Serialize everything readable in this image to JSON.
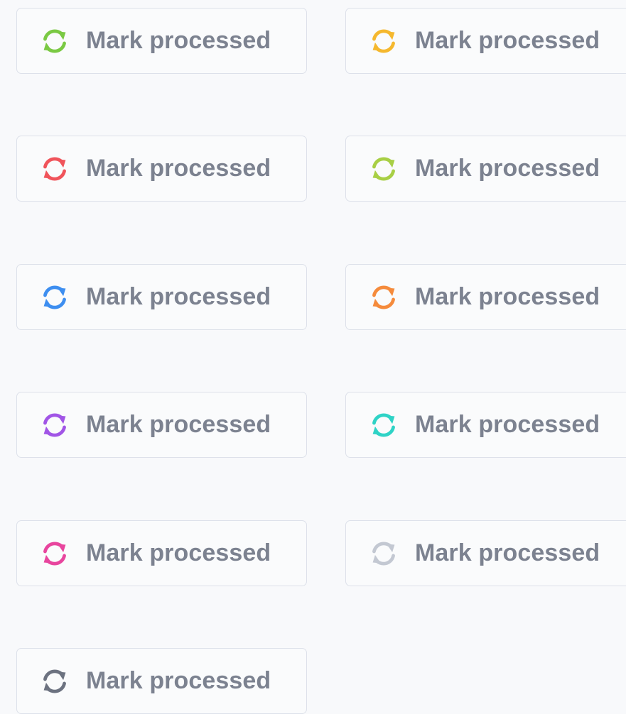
{
  "buttons": [
    {
      "label": "Mark processed",
      "icon": "refresh-icon",
      "color": "#7ac943"
    },
    {
      "label": "Mark processed",
      "icon": "refresh-icon",
      "color": "#f5b82e"
    },
    {
      "label": "Mark processed",
      "icon": "refresh-icon",
      "color": "#f0545b"
    },
    {
      "label": "Mark processed",
      "icon": "refresh-icon",
      "color": "#a8cf45"
    },
    {
      "label": "Mark processed",
      "icon": "refresh-icon",
      "color": "#3d8ef0"
    },
    {
      "label": "Mark processed",
      "icon": "refresh-icon",
      "color": "#f58b3c"
    },
    {
      "label": "Mark processed",
      "icon": "refresh-icon",
      "color": "#a155e6"
    },
    {
      "label": "Mark processed",
      "icon": "refresh-icon",
      "color": "#2fd3c6"
    },
    {
      "label": "Mark processed",
      "icon": "refresh-icon",
      "color": "#e8459e"
    },
    {
      "label": "Mark processed",
      "icon": "refresh-icon",
      "color": "#c3c8d2"
    },
    {
      "label": "Mark processed",
      "icon": "refresh-icon",
      "color": "#6c7280"
    }
  ]
}
